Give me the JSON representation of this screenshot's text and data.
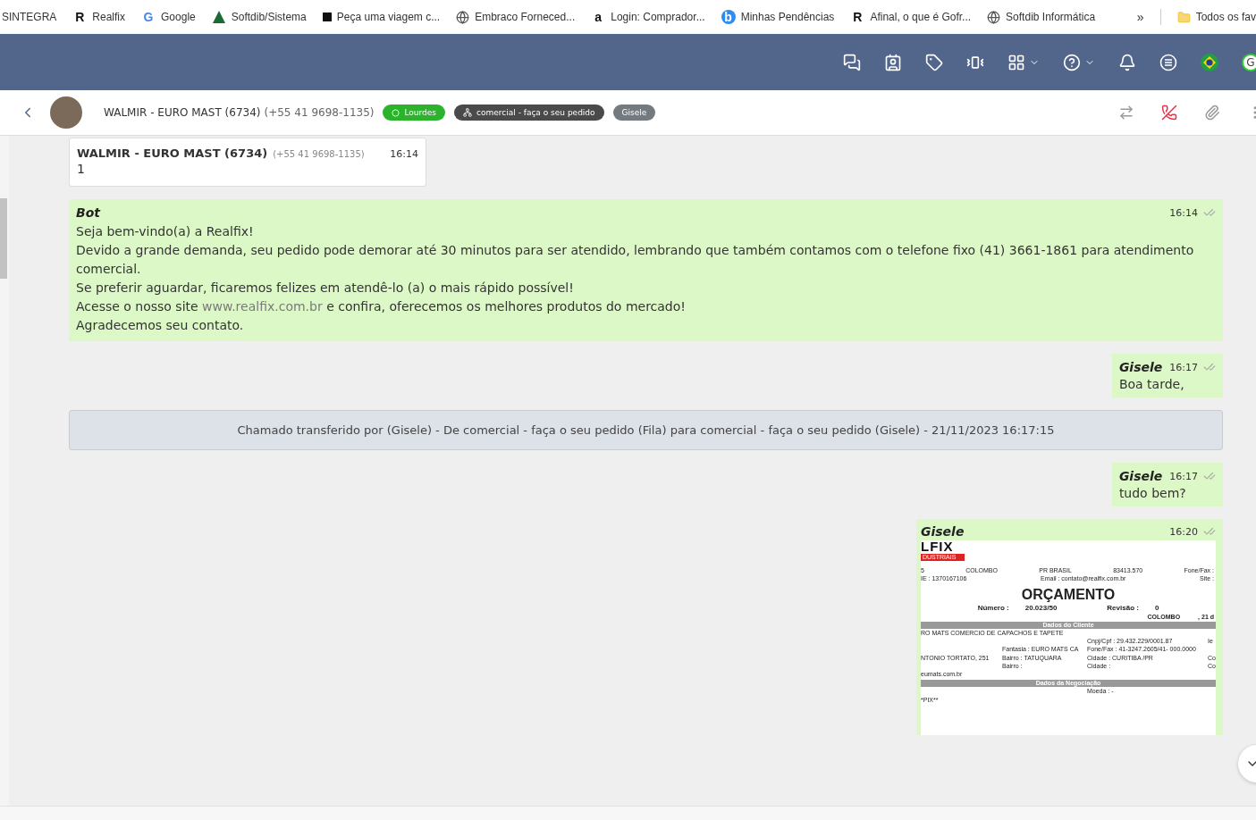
{
  "bookmarks": [
    {
      "label": "SINTEGRA",
      "kind": "text"
    },
    {
      "label": "Realfix",
      "kind": "letter",
      "glyph": "R"
    },
    {
      "label": "Google",
      "kind": "google",
      "glyph": "G"
    },
    {
      "label": "Softdib/Sistema",
      "kind": "tree"
    },
    {
      "label": "Peça uma viagem c...",
      "kind": "square"
    },
    {
      "label": "Embraco Forneced...",
      "kind": "globe"
    },
    {
      "label": "Login: Comprador...",
      "kind": "letter",
      "glyph": "a"
    },
    {
      "label": "Minhas Pendências",
      "kind": "badge",
      "glyph": "b"
    },
    {
      "label": "Afinal, o que é Gofr...",
      "kind": "letter",
      "glyph": "R"
    },
    {
      "label": "Softdib Informática",
      "kind": "globe"
    }
  ],
  "bookmarks_more": "»",
  "bookmarks_folder": "Todos os fav",
  "topbar": {
    "avatar_letter": "G"
  },
  "chat_header": {
    "name": "WALMIR - EURO MAST (6734)",
    "phone": "(+55 41 9698-1135)",
    "tags": [
      {
        "label": "Lourdes",
        "kind": "whatsapp",
        "color": "#2bb32b"
      },
      {
        "label": "comercial - faça o seu pedido",
        "kind": "queue",
        "color": "#4a4a4a"
      },
      {
        "label": "Gisele",
        "kind": "plain",
        "color": "#737a80"
      }
    ]
  },
  "messages": [
    {
      "kind": "contact",
      "name": "WALMIR - EURO MAST (6734)",
      "phone": "(+55 41 9698-1135)",
      "time": "16:14",
      "text": "1"
    },
    {
      "kind": "bot",
      "sender": "Bot",
      "time": "16:14",
      "lines": [
        "Seja bem-vindo(a) a Realfix!",
        "Devido a grande demanda, seu pedido pode demorar até 30 minutos para ser atendido, lembrando que também contamos com o telefone fixo (41) 3661-1861 para atendimento comercial.",
        "Se preferir aguardar, ficaremos felizes em atendê-lo (a) o mais rápido possível!"
      ],
      "link_line": {
        "before": "Acesse o nosso site",
        "link": "www.realfix.com.br",
        "after": "e confira, oferecemos os melhores produtos do mercado!"
      },
      "last_line": "Agradecemos seu contato."
    },
    {
      "kind": "outgoing",
      "sender": "Gisele",
      "time": "16:17",
      "text": "Boa tarde,"
    },
    {
      "kind": "notice",
      "text": "Chamado transferido por (Gisele) - De comercial - faça o seu pedido (Fila) para comercial - faça o seu pedido (Gisele) - 21/11/2023 16:17:15"
    },
    {
      "kind": "outgoing",
      "sender": "Gisele",
      "time": "16:17",
      "text": "tudo bem?"
    },
    {
      "kind": "image",
      "sender": "Gisele",
      "time": "16:20",
      "doc": {
        "logo": "LFIX",
        "logo_sub": "DUSTRIAIS",
        "header_rows": [
          [
            "5",
            "COLOMBO",
            "PR   BRASIL",
            "83413.570",
            "Fone/Fax :"
          ],
          [
            "IE :   1370167106",
            "Email :   contato@realfix.com.br",
            "Site :"
          ]
        ],
        "title": "ORÇAMENTO",
        "number_label": "Número :",
        "number": "20.023/50",
        "revision_label": "Revisão :",
        "revision": "0",
        "city_row": [
          "COLOMBO",
          ", 21 d"
        ],
        "sections": [
          {
            "title": "Dados do Cliente",
            "rows": [
              [
                "RO MATS COMERCIO DE CAPACHOS E TAPETE",
                "",
                "Cnpj/Cpf  :  29.432.229/0001.87",
                "Ie"
              ],
              [
                "",
                "Fantasia  :  EURO MATS CA",
                "Fone/Fax  :  41-3247.2605/41- 000.0000",
                ""
              ],
              [
                "NTONIO TORTATO, 251",
                "Bairro  :  TATUQUARA",
                "Cidade  :  CURITIBA   /PR",
                "Co"
              ],
              [
                "",
                "Bairro  :",
                "Cidade  :",
                "Co"
              ],
              [
                "eumats.com.br",
                "",
                "",
                ""
              ]
            ]
          },
          {
            "title": "Dados da Negociação",
            "rows": [
              [
                "",
                "",
                "Moeda  :  -",
                ""
              ],
              [
                "*PIX**",
                "",
                "",
                ""
              ]
            ]
          }
        ]
      }
    }
  ]
}
